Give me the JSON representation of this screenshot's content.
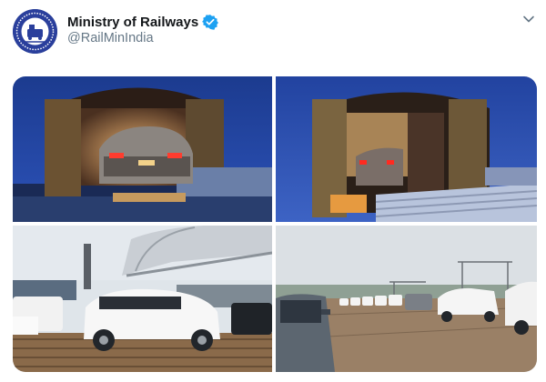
{
  "account": {
    "display_name": "Ministry of Railways",
    "handle": "@RailMinIndia",
    "avatar_icon": "railway-emblem-icon",
    "verified_icon": "verified-badge-icon",
    "verified_color": "#1da1f2"
  },
  "menu_icon": "chevron-down-icon",
  "photos": [
    {
      "id": "photo-1"
    },
    {
      "id": "photo-2"
    },
    {
      "id": "photo-3"
    },
    {
      "id": "photo-4"
    }
  ]
}
